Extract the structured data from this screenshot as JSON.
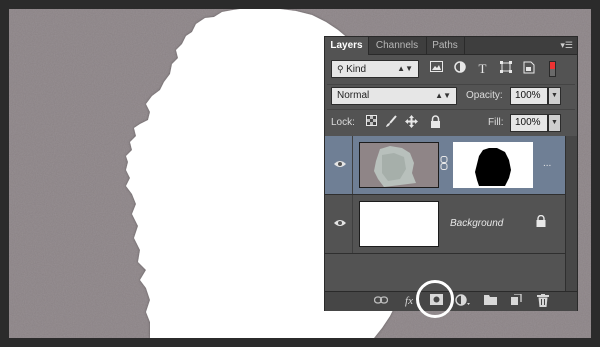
{
  "panel": {
    "tabs": [
      "Layers",
      "Channels",
      "Paths"
    ],
    "menu_icon": "panel-menu-icon",
    "filter": {
      "kind_label": "Kind",
      "icons": [
        "image-filter-icon",
        "adjustment-filter-icon",
        "type-filter-icon",
        "shape-filter-icon",
        "smart-object-filter-icon"
      ],
      "type_glyph": "T"
    },
    "blend_mode": "Normal",
    "opacity_label": "Opacity:",
    "opacity_value": "100%",
    "lock_label": "Lock:",
    "lock_icons": [
      "lock-transparent-pixels-icon",
      "lock-image-pixels-icon",
      "lock-position-icon",
      "lock-all-icon"
    ],
    "fill_label": "Fill:",
    "fill_value": "100%"
  },
  "layers": [
    {
      "name": "",
      "selected": true,
      "has_mask": true,
      "visible": true,
      "dots": "..."
    },
    {
      "name": "Background",
      "selected": false,
      "has_mask": false,
      "visible": true,
      "locked": true
    }
  ],
  "bottom_bar": {
    "icons": [
      "link-layers-icon",
      "layer-style-icon",
      "add-mask-icon",
      "adjustment-layer-icon",
      "new-group-icon",
      "new-layer-icon",
      "delete-layer-icon"
    ],
    "fx_label": "fx"
  },
  "colors": {
    "selected_layer": "#6f7f95",
    "panel_bg": "#535353",
    "highlight_ring": "#ffffff"
  }
}
